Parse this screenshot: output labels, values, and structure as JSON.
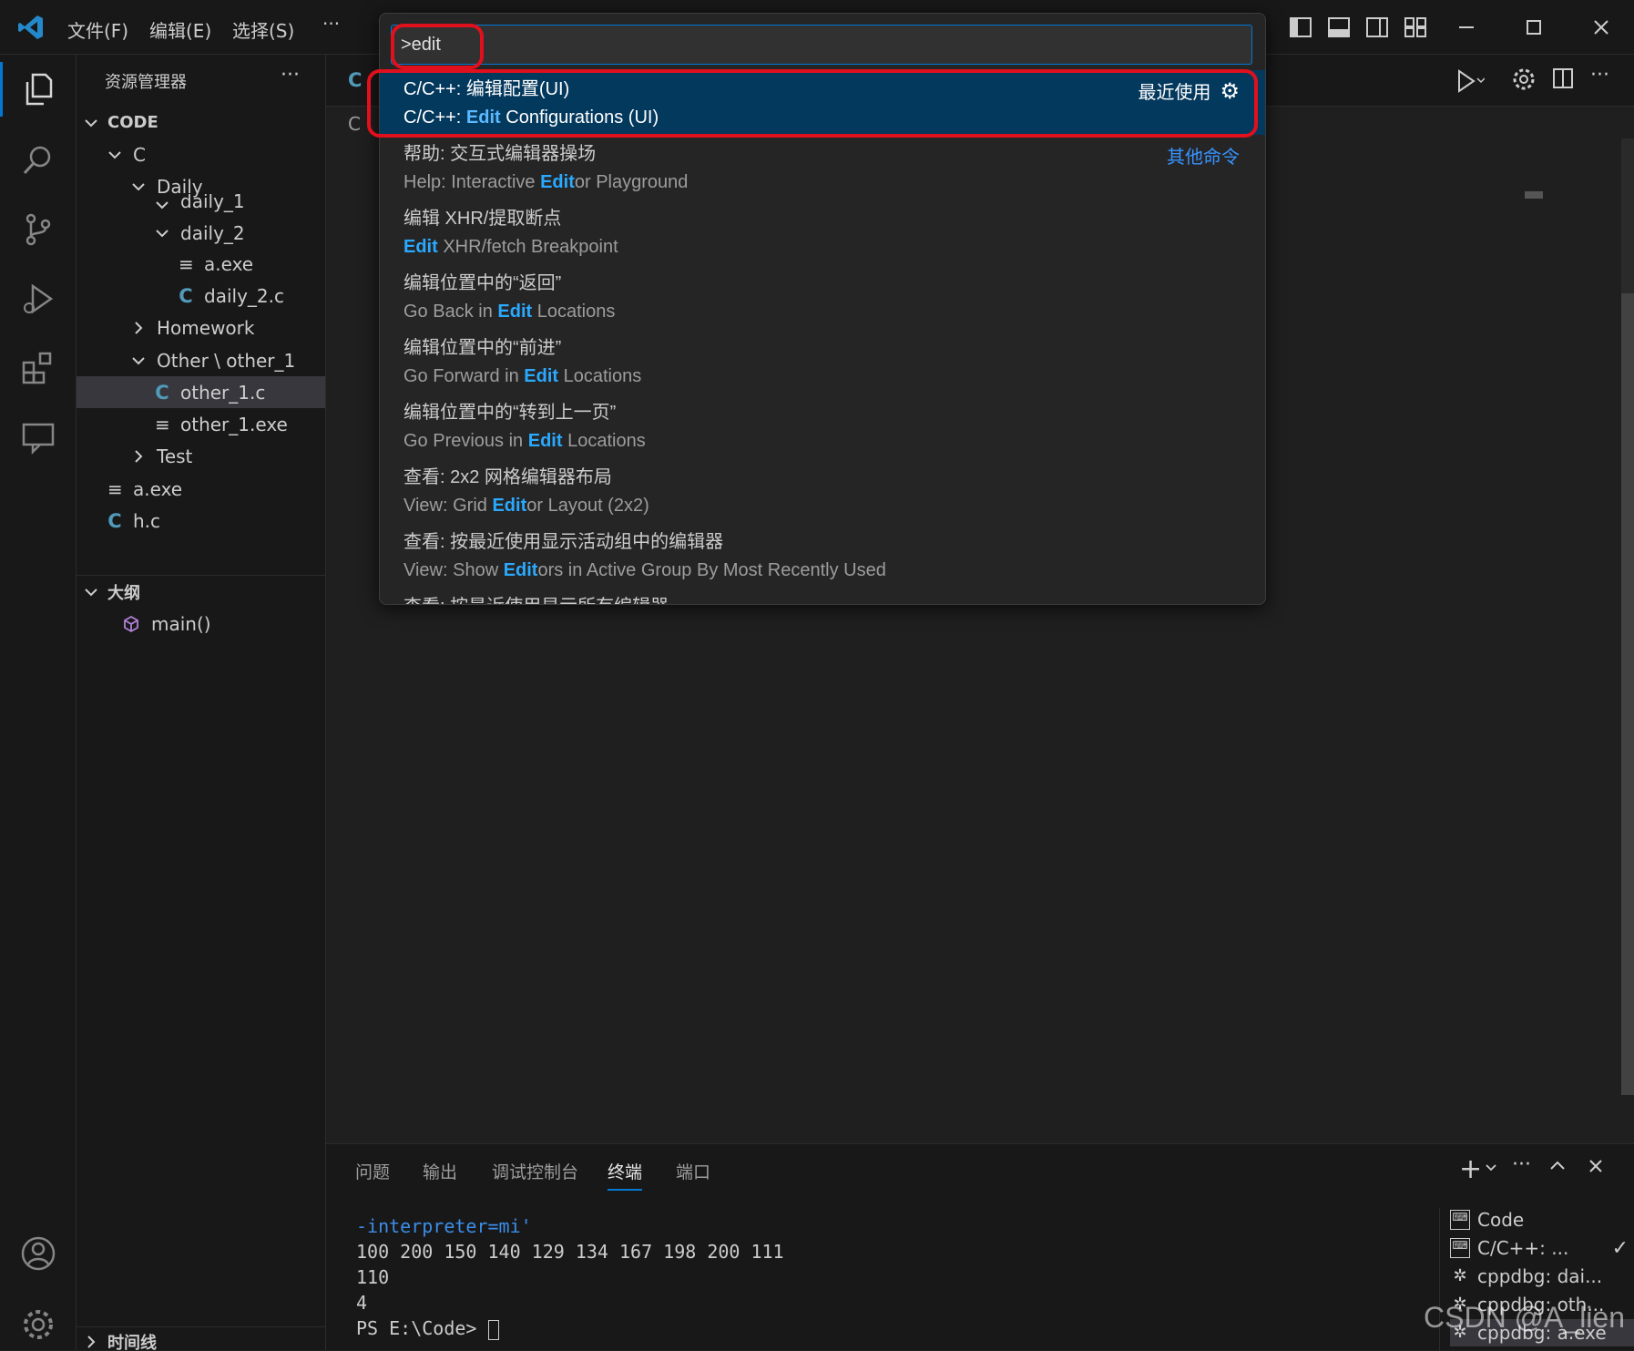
{
  "titlebar": {
    "menus": [
      "文件(F)",
      "编辑(E)",
      "选择(S)"
    ],
    "more": "···"
  },
  "sidebar": {
    "title": "资源管理器",
    "more": "···",
    "workspace": "CODE",
    "tree": [
      {
        "label": "C",
        "indent": 1,
        "chevron": "down",
        "icon": ""
      },
      {
        "label": "Daily",
        "indent": 2,
        "chevron": "down",
        "icon": ""
      },
      {
        "label": "daily_1",
        "indent": 3,
        "chevron": "down",
        "icon": ""
      },
      {
        "label": "daily_2",
        "indent": 3,
        "chevron": "down",
        "icon": ""
      },
      {
        "label": "a.exe",
        "indent": 4,
        "chevron": "",
        "icon": "exe"
      },
      {
        "label": "daily_2.c",
        "indent": 4,
        "chevron": "",
        "icon": "c"
      },
      {
        "label": "Homework",
        "indent": 2,
        "chevron": "right",
        "icon": ""
      },
      {
        "label": "Other \\ other_1",
        "indent": 2,
        "chevron": "down",
        "icon": ""
      },
      {
        "label": "other_1.c",
        "indent": 3,
        "chevron": "",
        "icon": "c",
        "selected": true
      },
      {
        "label": "other_1.exe",
        "indent": 3,
        "chevron": "",
        "icon": "exe"
      },
      {
        "label": "Test",
        "indent": 2,
        "chevron": "right",
        "icon": ""
      },
      {
        "label": "a.exe",
        "indent": 1,
        "chevron": "",
        "icon": "exe"
      },
      {
        "label": "h.c",
        "indent": 1,
        "chevron": "",
        "icon": "c"
      }
    ],
    "outline_title": "大纲",
    "outline_item": "main()",
    "timeline_title": "时间线"
  },
  "palette": {
    "input_value": ">edit",
    "recent_label": "最近使用",
    "other_label": "其他命令",
    "items": [
      {
        "l1": "C/C++: 编辑配置(UI)",
        "l2_pre": "C/C++: ",
        "l2_hl": "Edit",
        "l2_post": " Configurations (UI)",
        "selected": true
      },
      {
        "l1": "帮助: 交互式编辑器操场",
        "l2_pre": "Help: Interactive ",
        "l2_hl": "Edit",
        "l2_post": "or Playground"
      },
      {
        "l1": "编辑 XHR/提取断点",
        "l2_pre": "",
        "l2_hl": "Edit",
        "l2_post": " XHR/fetch Breakpoint"
      },
      {
        "l1": "编辑位置中的“返回”",
        "l2_pre": "Go Back in ",
        "l2_hl": "Edit",
        "l2_post": " Locations"
      },
      {
        "l1": "编辑位置中的“前进”",
        "l2_pre": "Go Forward in ",
        "l2_hl": "Edit",
        "l2_post": " Locations"
      },
      {
        "l1": "编辑位置中的“转到上一页”",
        "l2_pre": "Go Previous in ",
        "l2_hl": "Edit",
        "l2_post": " Locations"
      },
      {
        "l1": "查看: 2x2 网格编辑器布局",
        "l2_pre": "View: Grid ",
        "l2_hl": "Edit",
        "l2_post": "or Layout (2x2)"
      },
      {
        "l1": "查看: 按最近使用显示活动组中的编辑器",
        "l2_pre": "View: Show ",
        "l2_hl": "Edit",
        "l2_post": "ors in Active Group By Most Recently Used"
      },
      {
        "l1": "查看: 按最近使用显示所有编辑器",
        "l2_pre": "",
        "l2_hl": "",
        "l2_post": ""
      }
    ]
  },
  "editor": {
    "tab_letter": "C",
    "breadcrumb_letter": "C"
  },
  "panel": {
    "tabs": [
      "问题",
      "输出",
      "调试控制台",
      "终端",
      "端口"
    ],
    "active_tab": "终端",
    "terminal_lines": [
      "-interpreter=mi'",
      "100 200 150 140 129 134 167 198 200 111",
      "110",
      "4",
      "PS E:\\Code> "
    ],
    "terminals": [
      "Code",
      "C/C++: ...",
      "cppdbg: dai...",
      "cppdbg: oth...",
      "cppdbg: a.exe"
    ]
  },
  "watermark": "CSDN @A_lien",
  "colors": {
    "accent": "#0078d4",
    "highlight": "#2aaaff",
    "selection": "#04395e",
    "annotation": "#e0101c"
  }
}
